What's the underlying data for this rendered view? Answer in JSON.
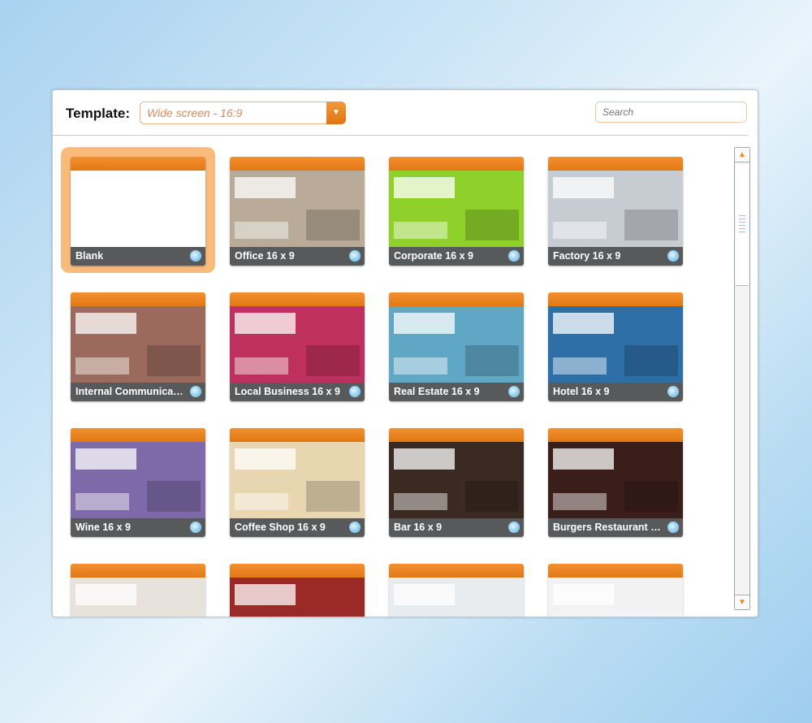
{
  "header": {
    "template_label": "Template:",
    "template_value": "Wide screen - 16:9",
    "search_placeholder": "Search"
  },
  "templates": [
    {
      "label": "Blank",
      "color": "#ffffff",
      "selected": true
    },
    {
      "label": "Office 16 x 9",
      "color": "#b9ab98"
    },
    {
      "label": "Corporate 16 x 9",
      "color": "#8fd12a"
    },
    {
      "label": "Factory 16 x 9",
      "color": "#c7ccd3"
    },
    {
      "label": "Internal Communicati...",
      "color": "#9b6a5c"
    },
    {
      "label": "Local Business 16 x 9",
      "color": "#c0305e"
    },
    {
      "label": "Real Estate 16 x 9",
      "color": "#5fa7c4"
    },
    {
      "label": "Hotel 16 x 9",
      "color": "#2f6fa8"
    },
    {
      "label": "Wine 16 x 9",
      "color": "#7e6aa8"
    },
    {
      "label": "Coffee Shop 16 x 9",
      "color": "#e7d6b0"
    },
    {
      "label": "Bar 16 x 9",
      "color": "#3b2a22"
    },
    {
      "label": "Burgers Restaurant 1...",
      "color": "#3a1e1a"
    },
    {
      "label": "",
      "color": "#e8e2dc"
    },
    {
      "label": "",
      "color": "#9b2a26"
    },
    {
      "label": "",
      "color": "#e9ecef"
    },
    {
      "label": "",
      "color": "#f2f2f2"
    }
  ]
}
